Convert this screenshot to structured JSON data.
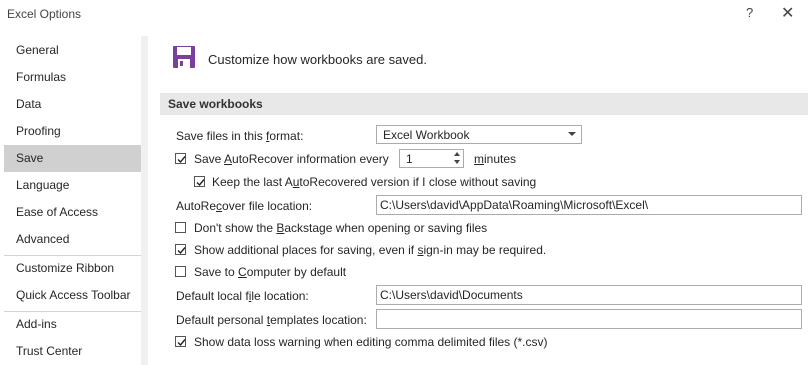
{
  "window": {
    "title": "Excel Options",
    "help_glyph": "?",
    "close_glyph": "✕"
  },
  "sidebar": {
    "items": [
      {
        "label": "General"
      },
      {
        "label": "Formulas"
      },
      {
        "label": "Data"
      },
      {
        "label": "Proofing"
      },
      {
        "label": "Save",
        "selected": true
      },
      {
        "label": "Language"
      },
      {
        "label": "Ease of Access"
      },
      {
        "label": "Advanced"
      },
      {
        "label": "Customize Ribbon"
      },
      {
        "label": "Quick Access Toolbar"
      },
      {
        "label": "Add-ins"
      },
      {
        "label": "Trust Center"
      }
    ]
  },
  "header": {
    "text": "Customize how workbooks are saved.",
    "icon": "floppy-disk-icon",
    "icon_color": "#7b3f9e"
  },
  "section": {
    "title": "Save workbooks"
  },
  "save_format": {
    "label_pre": "Save files in this ",
    "label_u": "f",
    "label_post": "ormat:",
    "value": "Excel Workbook"
  },
  "autorecover": {
    "checked": true,
    "label_pre": "Save ",
    "label_u": "A",
    "label_post": "utoRecover information every",
    "minutes_value": "1",
    "minutes_u": "m",
    "minutes_post": "inutes"
  },
  "keep_last": {
    "checked": true,
    "label_pre": "Keep the last A",
    "label_u": "u",
    "label_post": "toRecovered version if I close without saving"
  },
  "autorecover_location": {
    "label_pre": "AutoRe",
    "label_u": "c",
    "label_post": "over file location:",
    "value": "C:\\Users\\david\\AppData\\Roaming\\Microsoft\\Excel\\"
  },
  "backstage": {
    "checked": false,
    "label_pre": "Don't show the ",
    "label_u": "B",
    "label_post": "ackstage when opening or saving files"
  },
  "additional_places": {
    "checked": true,
    "label_pre": "Show additional places for saving, even if ",
    "label_u": "s",
    "label_post": "ign-in may be required."
  },
  "save_to_computer": {
    "checked": false,
    "label_pre": "Save to ",
    "label_u": "C",
    "label_post": "omputer by default"
  },
  "default_local": {
    "label_pre": "Default local f",
    "label_u": "i",
    "label_post": "le location:",
    "value": "C:\\Users\\david\\Documents"
  },
  "default_templates": {
    "label_pre": "Default personal ",
    "label_u": "t",
    "label_post": "emplates location:",
    "value": ""
  },
  "data_loss": {
    "checked": true,
    "label": "Show data loss warning when editing comma delimited files (*.csv)"
  }
}
